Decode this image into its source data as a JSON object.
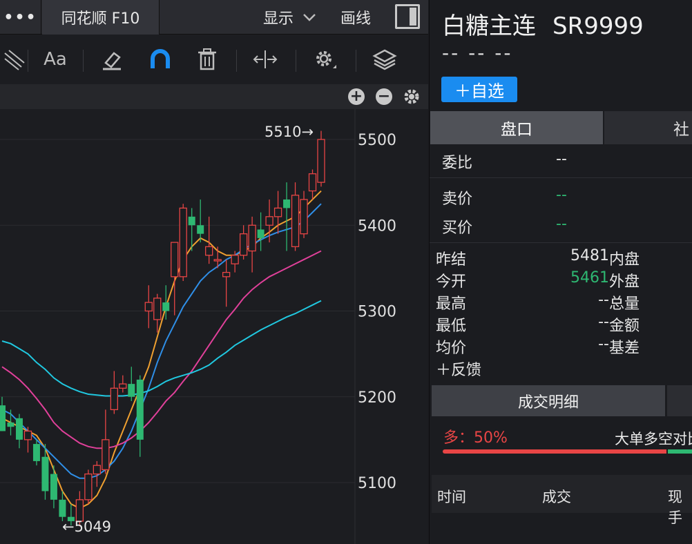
{
  "topbar": {
    "more_label": "•••",
    "f10_label": "同花顺 F10",
    "display_label": "显示",
    "drawline_label": "画线"
  },
  "toolbar": {
    "font_label": "Aa"
  },
  "chart_data": {
    "type": "candlestick",
    "y_ticks": [
      "5500",
      "5400",
      "5300",
      "5200",
      "5100"
    ],
    "ylim": [
      5050,
      5512
    ],
    "max_label": "5510→",
    "min_label": "←5049",
    "candles": [
      [
        5190,
        5200,
        5160,
        5160
      ],
      [
        5170,
        5185,
        5155,
        5165
      ],
      [
        5175,
        5180,
        5140,
        5150
      ],
      [
        5150,
        5165,
        5135,
        5160
      ],
      [
        5145,
        5150,
        5120,
        5125
      ],
      [
        5130,
        5145,
        5080,
        5090
      ],
      [
        5110,
        5120,
        5070,
        5080
      ],
      [
        5080,
        5090,
        5055,
        5060
      ],
      [
        5060,
        5075,
        5050,
        5055
      ],
      [
        5055,
        5090,
        5049,
        5080
      ],
      [
        5080,
        5115,
        5075,
        5110
      ],
      [
        5110,
        5125,
        5095,
        5120
      ],
      [
        5115,
        5185,
        5110,
        5150
      ],
      [
        5185,
        5230,
        5180,
        5210
      ],
      [
        5210,
        5225,
        5205,
        5215
      ],
      [
        5215,
        5235,
        5195,
        5200
      ],
      [
        5220,
        5225,
        5130,
        5150
      ],
      [
        5300,
        5330,
        5280,
        5310
      ],
      [
        5290,
        5320,
        5275,
        5315
      ],
      [
        5310,
        5330,
        5290,
        5300
      ],
      [
        5340,
        5380,
        5295,
        5380
      ],
      [
        5340,
        5425,
        5335,
        5420
      ],
      [
        5410,
        5420,
        5370,
        5400
      ],
      [
        5400,
        5430,
        5380,
        5390
      ],
      [
        5365,
        5410,
        5355,
        5375
      ],
      [
        5360,
        5375,
        5350,
        5360
      ],
      [
        5340,
        5360,
        5305,
        5345
      ],
      [
        5355,
        5370,
        5345,
        5365
      ],
      [
        5365,
        5400,
        5360,
        5390
      ],
      [
        5370,
        5410,
        5345,
        5400
      ],
      [
        5395,
        5415,
        5370,
        5385
      ],
      [
        5400,
        5430,
        5380,
        5410
      ],
      [
        5410,
        5440,
        5390,
        5420
      ],
      [
        5430,
        5450,
        5370,
        5420
      ],
      [
        5375,
        5450,
        5370,
        5435
      ],
      [
        5390,
        5440,
        5385,
        5430
      ],
      [
        5440,
        5465,
        5430,
        5460
      ],
      [
        5450,
        5510,
        5445,
        5500
      ]
    ],
    "ma_lines": [
      {
        "color": "#f0a030",
        "values": [
          5175,
          5170,
          5165,
          5160,
          5155,
          5140,
          5115,
          5090,
          5075,
          5070,
          5075,
          5085,
          5105,
          5135,
          5160,
          5185,
          5210,
          5235,
          5270,
          5305,
          5335,
          5360,
          5375,
          5385,
          5380,
          5370,
          5365,
          5365,
          5370,
          5375,
          5385,
          5392,
          5400,
          5405,
          5410,
          5420,
          5430,
          5440
        ]
      },
      {
        "color": "#2f8fe8",
        "values": [
          5185,
          5180,
          5170,
          5160,
          5150,
          5140,
          5130,
          5120,
          5110,
          5105,
          5105,
          5108,
          5115,
          5125,
          5140,
          5160,
          5185,
          5210,
          5240,
          5265,
          5285,
          5305,
          5320,
          5335,
          5345,
          5352,
          5360,
          5365,
          5372,
          5378,
          5383,
          5388,
          5392,
          5395,
          5398,
          5405,
          5415,
          5425
        ]
      },
      {
        "color": "#e0409a",
        "values": [
          5235,
          5228,
          5220,
          5210,
          5198,
          5185,
          5170,
          5160,
          5153,
          5146,
          5142,
          5140,
          5140,
          5142,
          5146,
          5152,
          5160,
          5170,
          5182,
          5195,
          5205,
          5218,
          5230,
          5245,
          5260,
          5275,
          5290,
          5302,
          5315,
          5325,
          5333,
          5340,
          5345,
          5350,
          5355,
          5360,
          5365,
          5370
        ]
      },
      {
        "color": "#20c8e0",
        "values": [
          5265,
          5262,
          5256,
          5250,
          5240,
          5232,
          5222,
          5215,
          5210,
          5206,
          5203,
          5202,
          5201,
          5201,
          5201,
          5202,
          5204,
          5207,
          5212,
          5218,
          5222,
          5225,
          5228,
          5232,
          5237,
          5245,
          5252,
          5260,
          5266,
          5272,
          5278,
          5283,
          5288,
          5293,
          5297,
          5302,
          5307,
          5312
        ]
      }
    ]
  },
  "quote": {
    "name": "白糖主连",
    "code": "SR9999",
    "change": "-- -- --",
    "fav_label": "＋自选",
    "tab_pankou": "盘口",
    "tab_she": "社",
    "weibi_label": "委比",
    "weibi_value": "--",
    "sell_label": "卖价",
    "sell_value": "--",
    "buy_label": "买价",
    "buy_value": "--",
    "stats": [
      {
        "label": "昨结",
        "value": "5481",
        "side": "内盘",
        "green": false
      },
      {
        "label": "今开",
        "value": "5461",
        "side": "外盘",
        "green": true
      },
      {
        "label": "最高",
        "value": "--",
        "side": "总量",
        "green": false
      },
      {
        "label": "最低",
        "value": "--",
        "side": "金额",
        "green": false
      },
      {
        "label": "均价",
        "value": "--",
        "side": "基差",
        "green": false
      }
    ],
    "feedback": "＋反馈",
    "deal_tab": "成交明细",
    "long_pct": "多：50%",
    "bigorder": "大单多空对比",
    "col_time": "时间",
    "col_deal": "成交",
    "col_hand": "现手"
  },
  "colors": {
    "up": "#e84545",
    "down": "#2eb872",
    "accent": "#1a8cf0"
  }
}
